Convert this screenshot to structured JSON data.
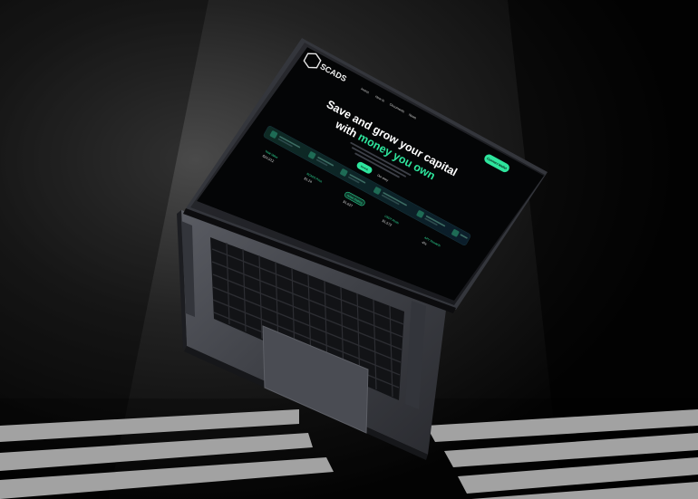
{
  "screen": {
    "brand": "SCADS",
    "nav": [
      "Invest",
      "How to",
      "Documents",
      "News"
    ],
    "cta_button": "Connect Wallet",
    "hero_line1": "Save and grow your capital",
    "hero_line2_prefix": "with ",
    "hero_line2_accent": "money you own",
    "primary_button": "Invest",
    "secondary_button": "Our story",
    "stats": [
      {
        "label": "Total Value",
        "value": "$24,912"
      },
      {
        "label": "SCADS Price",
        "value": "$1.24"
      },
      {
        "label": "Active Staking",
        "value": "$1,627"
      },
      {
        "label": "USDT Pools",
        "value": "$1,572"
      },
      {
        "label": "APY Rewards",
        "value": "4%"
      }
    ],
    "accent_color": "#2ee59d"
  }
}
